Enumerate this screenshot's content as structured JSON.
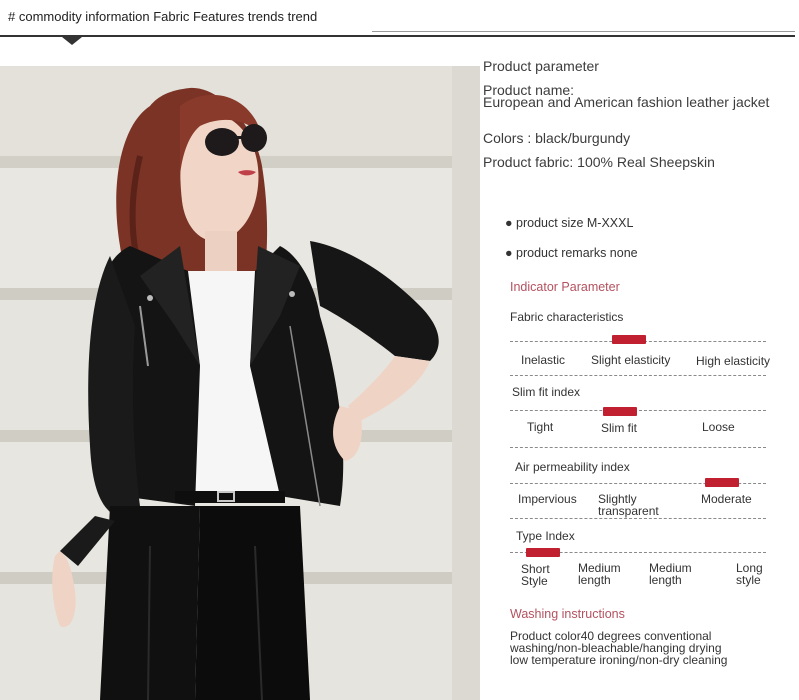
{
  "header": {
    "title": "# commodity information Fabric Features trends trend"
  },
  "product": {
    "parameter_heading": "Product parameter",
    "name_label": "Product name:",
    "name_value": "European and American fashion leather jacket",
    "colors": "Colors : black/burgundy",
    "fabric": "Product fabric: 100% Real Sheepskin",
    "size": "product size M-XXXL",
    "remarks": "product remarks none"
  },
  "indicator": {
    "heading": "Indicator Parameter",
    "groups": [
      {
        "title": "Fabric characteristics",
        "labels": [
          "Inelastic",
          "Slight elasticity",
          "High elasticity"
        ],
        "selected": "Slight elasticity"
      },
      {
        "title": "Slim fit index",
        "labels": [
          "Tight",
          "Slim fit",
          "Loose"
        ],
        "selected": "Slim fit"
      },
      {
        "title": "Air permeability index",
        "labels": [
          "Impervious",
          "Slightly transparent",
          "Moderate"
        ],
        "selected": "Moderate"
      },
      {
        "title": "Type Index",
        "labels": [
          "Short Style",
          "Medium length",
          "Medium length",
          "Long style"
        ],
        "selected": "Short Style"
      }
    ],
    "accent_color": "#c0202f"
  },
  "washing": {
    "heading": "Washing instructions",
    "text": "Product color40 degrees conventional washing/non-bleachable/hanging drying low temperature ironing/non-dry cleaning"
  }
}
